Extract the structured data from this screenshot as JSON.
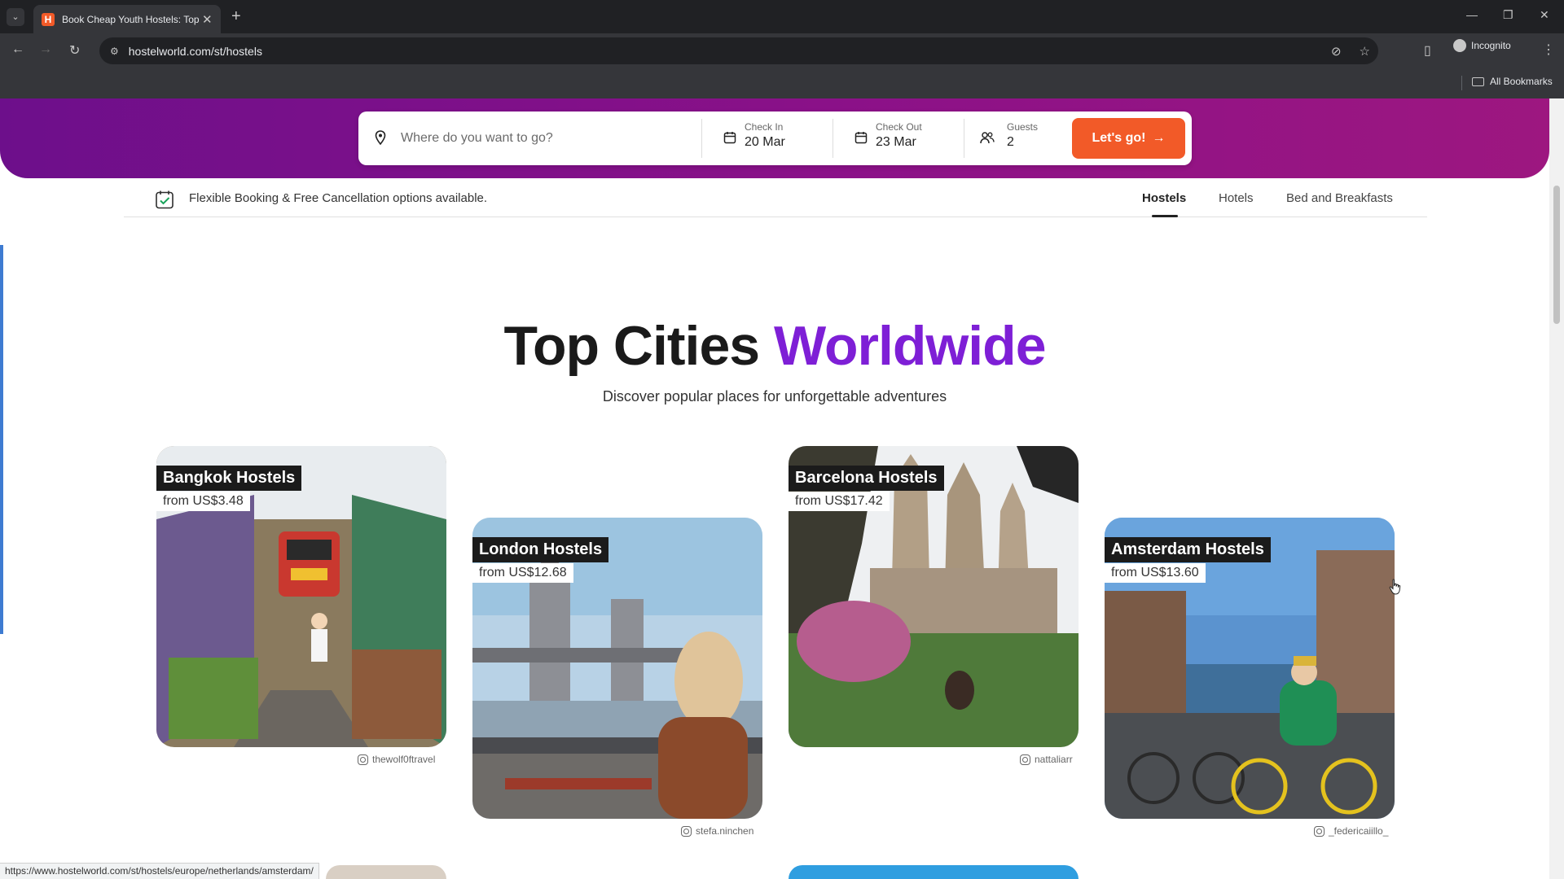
{
  "browser": {
    "tab_title": "Book Cheap Youth Hostels: Top",
    "url": "hostelworld.com/st/hostels",
    "profile_label": "Incognito",
    "bookmarks_label": "All Bookmarks",
    "status_url": "https://www.hostelworld.com/st/hostels/europe/netherlands/amsterdam/"
  },
  "search": {
    "destination_placeholder": "Where do you want to go?",
    "check_in_label": "Check In",
    "check_in_value": "20 Mar",
    "check_out_label": "Check Out",
    "check_out_value": "23 Mar",
    "guests_label": "Guests",
    "guests_value": "2",
    "submit_label": "Let's go!"
  },
  "info": {
    "flexible_text": "Flexible Booking & Free Cancellation options available.",
    "property_tabs": [
      "Hostels",
      "Hotels",
      "Bed and Breakfasts"
    ],
    "active_tab": "Hostels"
  },
  "section": {
    "title_main": "Top Cities",
    "title_accent": "Worldwide",
    "subtitle": "Discover popular places for unforgettable adventures"
  },
  "cities": [
    {
      "name": "Bangkok Hostels",
      "price": "from US$3.48",
      "credit": "thewolf0ftravel"
    },
    {
      "name": "London Hostels",
      "price": "from US$12.68",
      "credit": "stefa.ninchen"
    },
    {
      "name": "Barcelona Hostels",
      "price": "from US$17.42",
      "credit": "nattaliarr"
    },
    {
      "name": "Amsterdam Hostels",
      "price": "from US$13.60",
      "credit": "_federicaiillo_"
    }
  ],
  "colors": {
    "hero": "#7c0f8c",
    "accent_purple": "#7e1fd6",
    "cta_orange": "#f25a28"
  }
}
